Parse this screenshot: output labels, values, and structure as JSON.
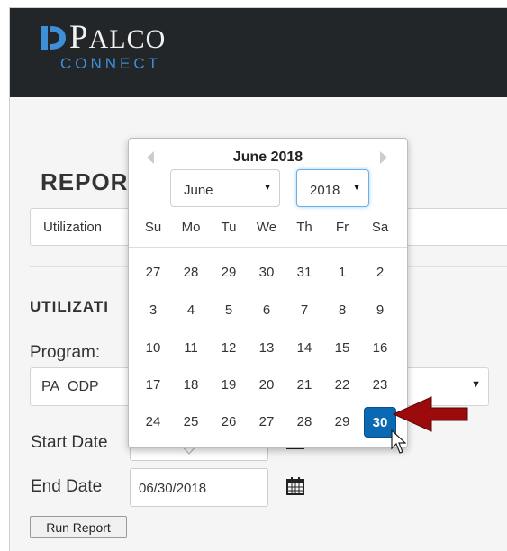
{
  "header": {
    "logo_main": "P",
    "logo_rest": "ALCO",
    "logo_sub": "CONNECT",
    "logo_icon": "palco-logo-icon"
  },
  "page": {
    "reports_title": "REPOR",
    "report_select_value": "Utilization",
    "section_title": "UTILIZATI",
    "program_label": "Program:",
    "program_value": "PA_ODP",
    "start_date_label": "Start Date",
    "end_date_label": "End Date",
    "end_date_value": "06/30/2018",
    "run_report_label": "Run Report",
    "calendar_icon": "calendar-icon"
  },
  "datepicker": {
    "title": "June 2018",
    "month_select": "June",
    "year_select": "2018",
    "weekdays": [
      "Su",
      "Mo",
      "Tu",
      "We",
      "Th",
      "Fr",
      "Sa"
    ],
    "weeks": [
      [
        "27",
        "28",
        "29",
        "30",
        "31",
        "1",
        "2"
      ],
      [
        "3",
        "4",
        "5",
        "6",
        "7",
        "8",
        "9"
      ],
      [
        "10",
        "11",
        "12",
        "13",
        "14",
        "15",
        "16"
      ],
      [
        "17",
        "18",
        "19",
        "20",
        "21",
        "22",
        "23"
      ],
      [
        "24",
        "25",
        "26",
        "27",
        "28",
        "29",
        "30"
      ]
    ],
    "selected_day": "30",
    "selected_color": "#0b68b3"
  },
  "annotation": {
    "arrow_color": "#9b0b0b"
  }
}
